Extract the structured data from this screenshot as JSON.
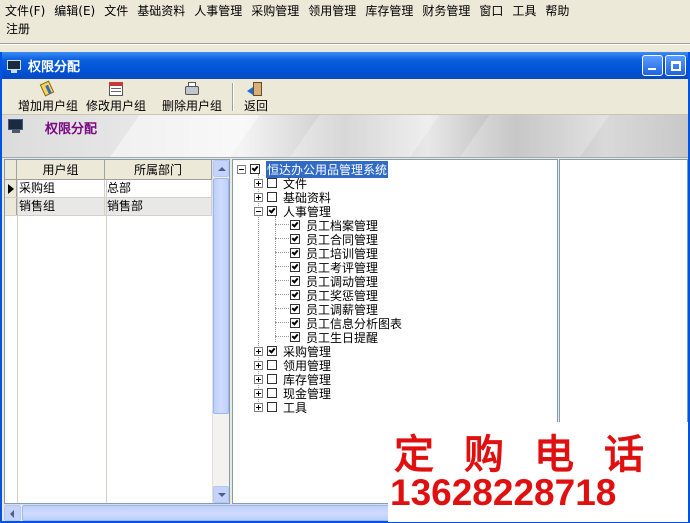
{
  "menubar": {
    "items": [
      "文件(F)",
      "编辑(E)",
      "文件",
      "基础资料",
      "人事管理",
      "采购管理",
      "领用管理",
      "库存管理",
      "财务管理",
      "窗口",
      "工具",
      "帮助"
    ],
    "second_row": "注册"
  },
  "window": {
    "title": "权限分配"
  },
  "toolbar": {
    "add_label": "增加用户组",
    "edit_label": "修改用户组",
    "delete_label": "删除用户组",
    "back_label": "返回"
  },
  "banner": {
    "title": "权限分配"
  },
  "grid": {
    "headers": [
      "用户组",
      "所属部门"
    ],
    "rows": [
      {
        "group": "采购组",
        "dept": "总部"
      },
      {
        "group": "销售组",
        "dept": "销售部"
      }
    ]
  },
  "tree": {
    "root": "恒达办公用品管理系统",
    "nodes": [
      {
        "label": "文件",
        "checked": false
      },
      {
        "label": "基础资料",
        "checked": false
      },
      {
        "label": "人事管理",
        "checked": true
      },
      {
        "label": "员工档案管理",
        "checked": true
      },
      {
        "label": "员工合同管理",
        "checked": true
      },
      {
        "label": "员工培训管理",
        "checked": true
      },
      {
        "label": "员工考评管理",
        "checked": true
      },
      {
        "label": "员工调动管理",
        "checked": true
      },
      {
        "label": "员工奖惩管理",
        "checked": true
      },
      {
        "label": "员工调薪管理",
        "checked": true
      },
      {
        "label": "员工信息分析图表",
        "checked": true
      },
      {
        "label": "员工生日提醒",
        "checked": true
      },
      {
        "label": "采购管理",
        "checked": true
      },
      {
        "label": "领用管理",
        "checked": false
      },
      {
        "label": "库存管理",
        "checked": false
      },
      {
        "label": "现金管理",
        "checked": false
      },
      {
        "label": "工具",
        "checked": false
      }
    ]
  },
  "overlay": {
    "line1": "定购电话",
    "line2": "13628228718"
  }
}
